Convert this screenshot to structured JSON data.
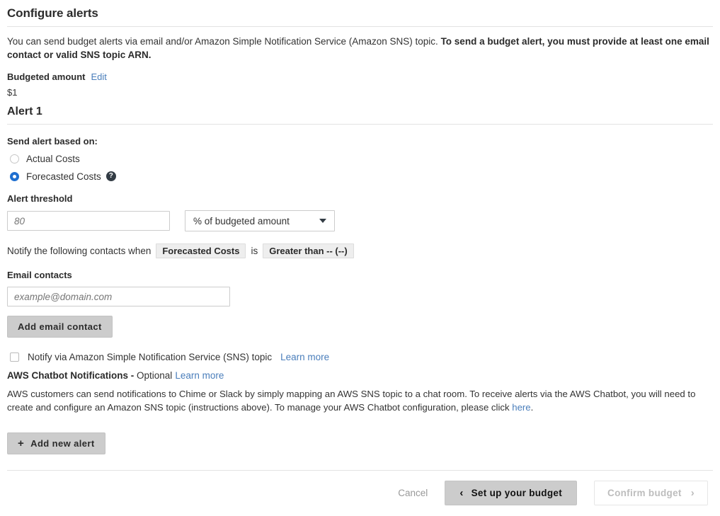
{
  "header": {
    "title": "Configure alerts",
    "description_part1": "You can send budget alerts via email and/or Amazon Simple Notification Service (Amazon SNS) topic. ",
    "description_bold": "To send a budget alert, you must provide at least one email contact or valid SNS topic ARN."
  },
  "budget": {
    "label": "Budgeted amount",
    "edit_link": "Edit",
    "amount": "$1"
  },
  "alert": {
    "section_title": "Alert 1",
    "basis_label": "Send alert based on:",
    "options": [
      {
        "label": "Actual Costs",
        "selected": false
      },
      {
        "label": "Forecasted Costs",
        "selected": true
      }
    ],
    "help_icon": "?",
    "threshold_label": "Alert threshold",
    "threshold_value": "",
    "threshold_placeholder": "80",
    "threshold_unit": "% of budgeted amount",
    "notify_prefix": "Notify the following contacts when",
    "notify_chip_basis": "Forecasted Costs",
    "notify_is": "is",
    "notify_chip_condition": "Greater than -- (--)",
    "email_label": "Email contacts",
    "email_value": "",
    "email_placeholder": "example@domain.com",
    "add_email_button": "Add email contact"
  },
  "sns": {
    "checkbox_label": "Notify via Amazon Simple Notification Service (SNS) topic",
    "checked": false,
    "learn_more": "Learn more"
  },
  "chatbot": {
    "title": "AWS Chatbot Notifications -",
    "optional": "Optional",
    "learn_more": "Learn more",
    "paragraph_part1": "AWS customers can send notifications to Chime or Slack by simply mapping an AWS SNS topic to a chat room. To receive alerts via the AWS Chatbot, you will need to create and configure an Amazon SNS topic (instructions above). To manage your AWS Chatbot configuration, please click ",
    "paragraph_link": "here",
    "paragraph_part2": "."
  },
  "actions": {
    "add_new_alert": "Add new alert",
    "plus_icon": "+"
  },
  "footer": {
    "cancel": "Cancel",
    "back_chevron": "‹",
    "back_label": "Set up your budget",
    "confirm_label": "Confirm budget",
    "forward_chevron": "›"
  },
  "colors": {
    "accent_blue": "#1f6fd0",
    "link_blue": "#4a7ebb",
    "button_grey": "#cccccc",
    "chip_grey": "#eeeeee"
  }
}
